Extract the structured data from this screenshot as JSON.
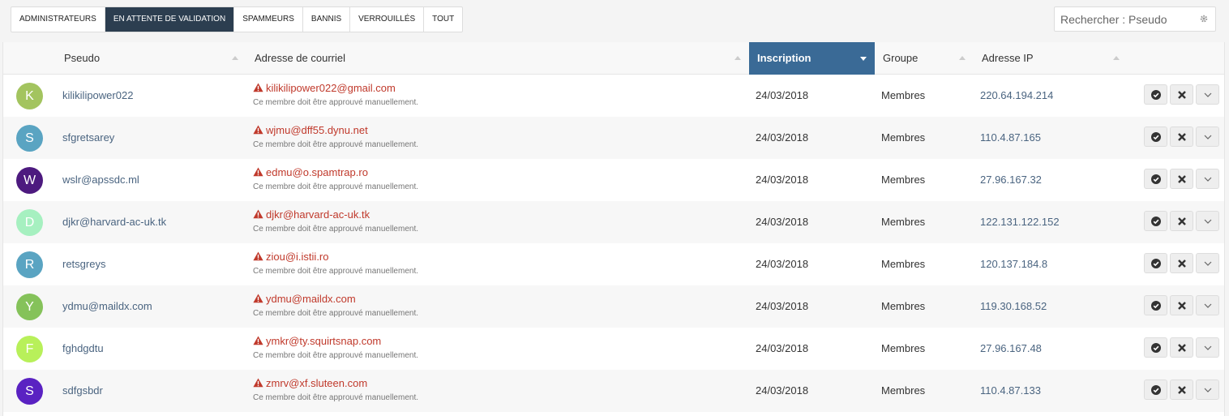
{
  "filters": [
    {
      "label": "ADMINISTRATEURS",
      "active": false
    },
    {
      "label": "EN ATTENTE DE VALIDATION",
      "active": true
    },
    {
      "label": "SPAMMEURS",
      "active": false
    },
    {
      "label": "BANNIS",
      "active": false
    },
    {
      "label": "VERROUILLÉS",
      "active": false
    },
    {
      "label": "TOUT",
      "active": false
    }
  ],
  "search": {
    "placeholder": "Rechercher : Pseudo",
    "icon": "gear-icon"
  },
  "columns": {
    "pseudo": "Pseudo",
    "email": "Adresse de courriel",
    "inscription": "Inscription",
    "groupe": "Groupe",
    "ip": "Adresse IP"
  },
  "sorted_column": "inscription",
  "accent_color": "#3a6a96",
  "members": [
    {
      "initial": "K",
      "avatar_color": "#a3c45f",
      "pseudo": "kilikilipower022",
      "email": "kilikilipower022@gmail.com",
      "note": "Ce membre doit être approuvé manuellement.",
      "date": "24/03/2018",
      "group": "Membres",
      "ip": "220.64.194.214"
    },
    {
      "initial": "S",
      "avatar_color": "#5aa4c2",
      "pseudo": "sfgretsarey",
      "email": "wjmu@dff55.dynu.net",
      "note": "Ce membre doit être approuvé manuellement.",
      "date": "24/03/2018",
      "group": "Membres",
      "ip": "110.4.87.165"
    },
    {
      "initial": "W",
      "avatar_color": "#4d1a7f",
      "pseudo": "wslr@apssdc.ml",
      "email": "edmu@o.spamtrap.ro",
      "note": "Ce membre doit être approuvé manuellement.",
      "date": "24/03/2018",
      "group": "Membres",
      "ip": "27.96.167.32"
    },
    {
      "initial": "D",
      "avatar_color": "#a6f0c0",
      "pseudo": "djkr@harvard-ac-uk.tk",
      "email": "djkr@harvard-ac-uk.tk",
      "note": "Ce membre doit être approuvé manuellement.",
      "date": "24/03/2018",
      "group": "Membres",
      "ip": "122.131.122.152"
    },
    {
      "initial": "R",
      "avatar_color": "#5aa4c2",
      "pseudo": "retsgreys",
      "email": "ziou@i.istii.ro",
      "note": "Ce membre doit être approuvé manuellement.",
      "date": "24/03/2018",
      "group": "Membres",
      "ip": "120.137.184.8"
    },
    {
      "initial": "Y",
      "avatar_color": "#85c25a",
      "pseudo": "ydmu@maildx.com",
      "email": "ydmu@maildx.com",
      "note": "Ce membre doit être approuvé manuellement.",
      "date": "24/03/2018",
      "group": "Membres",
      "ip": "119.30.168.52"
    },
    {
      "initial": "F",
      "avatar_color": "#b8f05a",
      "pseudo": "fghdgdtu",
      "email": "ymkr@ty.squirtsnap.com",
      "note": "Ce membre doit être approuvé manuellement.",
      "date": "24/03/2018",
      "group": "Membres",
      "ip": "27.96.167.48"
    },
    {
      "initial": "S",
      "avatar_color": "#5a22c2",
      "pseudo": "sdfgsbdr",
      "email": "zmrv@xf.sluteen.com",
      "note": "Ce membre doit être approuvé manuellement.",
      "date": "24/03/2018",
      "group": "Membres",
      "ip": "110.4.87.133"
    }
  ]
}
